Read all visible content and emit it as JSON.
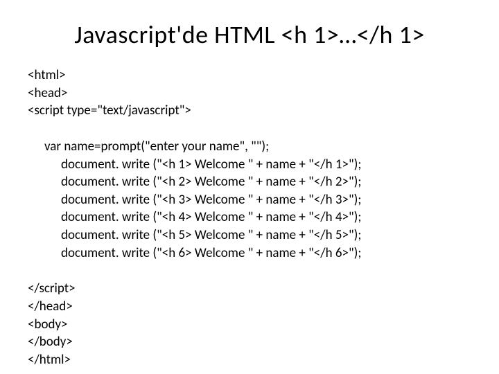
{
  "title": "Javascript'de HTML <h 1>…</h 1>",
  "code": {
    "l1": "<html>",
    "l2": "<head>",
    "l3": "<script type=\"text/javascript\">",
    "l4": "var name=prompt(\"enter your name\", \"\");",
    "l5": "document. write (\"<h 1> Welcome  \" + name + \"</h 1>\");",
    "l6": "document. write (\"<h 2> Welcome  \" + name + \"</h 2>\");",
    "l7": "document. write (\"<h 3> Welcome  \" + name + \"</h 3>\");",
    "l8": "document. write (\"<h 4> Welcome  \" + name + \"</h 4>\");",
    "l9": "document. write (\"<h 5> Welcome  \" + name + \"</h 5>\");",
    "l10": "document. write (\"<h 6> Welcome  \" + name + \"</h 6>\");",
    "l11": "</script>",
    "l12": "</head>",
    "l13": "<body>",
    "l14": "</body>",
    "l15": "</html>"
  }
}
